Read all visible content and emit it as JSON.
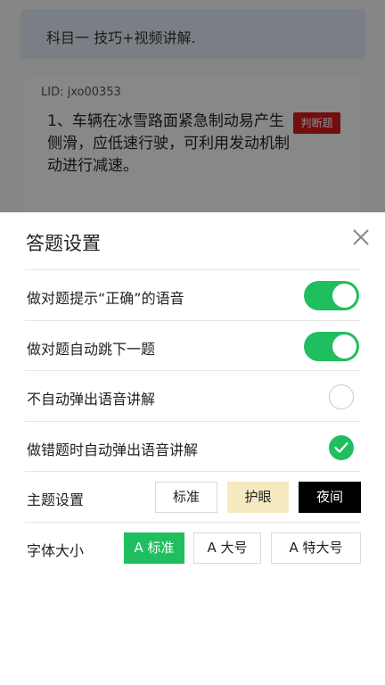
{
  "background": {
    "banner_text": "科目一 技巧+视频讲解.",
    "lid": "LID: jxo00353",
    "question": "1、车辆在冰雪路面紧急制动易产生侧滑，应低速行驶，可利用发动机制动进行减速。",
    "question_type": "判断题"
  },
  "sheet": {
    "title": "答题设置",
    "close_icon": "close-icon",
    "settings": [
      {
        "label": "做对题提示“正确”的语音",
        "control": "toggle",
        "on": true
      },
      {
        "label": "做对题自动跳下一题",
        "control": "toggle",
        "on": true
      },
      {
        "label": "不自动弹出语音讲解",
        "control": "radio",
        "checked": false
      },
      {
        "label": "做错题时自动弹出语音讲解",
        "control": "radio",
        "checked": true
      }
    ],
    "theme": {
      "label": "主题设置",
      "options": [
        "标准",
        "护眼",
        "夜间"
      ]
    },
    "font_size": {
      "label": "字体大小",
      "options": [
        "A 标准",
        "A 大号",
        "A 特大号"
      ],
      "selected": "A 标准"
    }
  },
  "colors": {
    "accent_green": "#1fbe5f",
    "badge_red": "#d21b1b",
    "eye_care_bg": "#f6eac0",
    "night_bg": "#000000"
  }
}
